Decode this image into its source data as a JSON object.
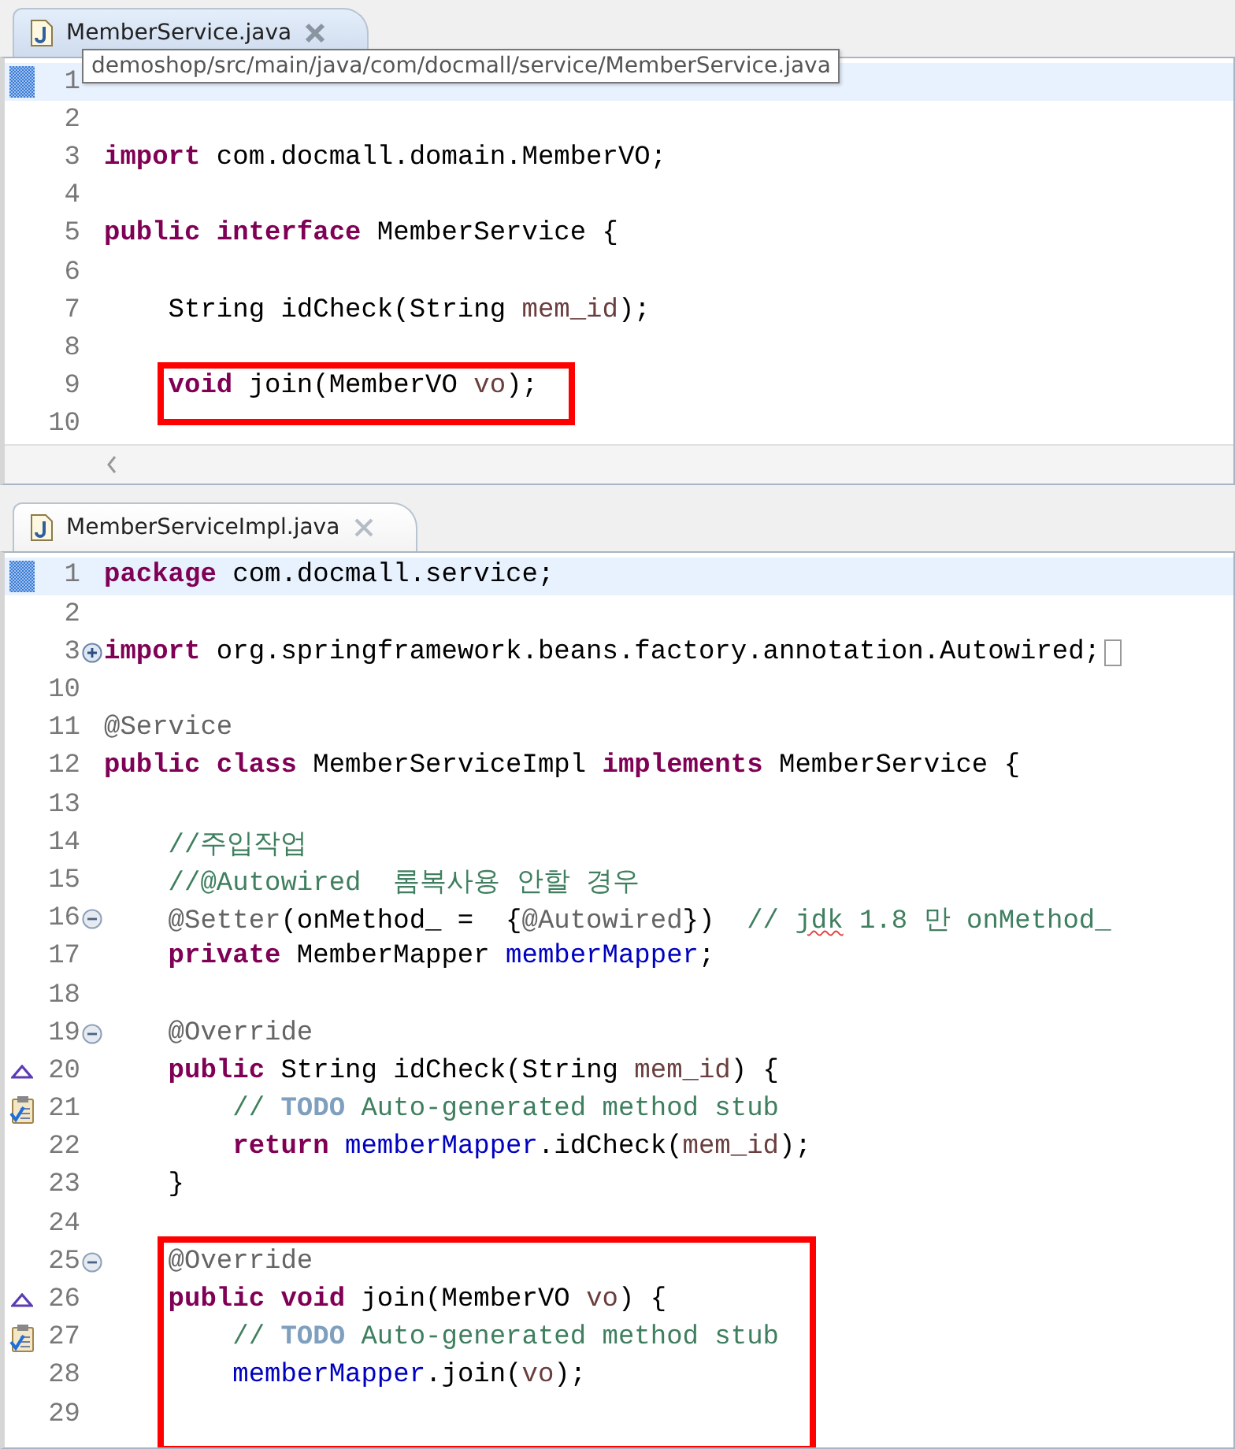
{
  "editors": [
    {
      "tab": {
        "label": "MemberService.java",
        "selected": true
      },
      "tooltip": {
        "text": "demoshop/src/main/java/com/docmall/service/MemberService.java"
      },
      "lines": [
        {
          "number": "1",
          "kind": "current",
          "boxed": false
        },
        {
          "number": "2",
          "kind": "plain",
          "boxed": false
        },
        {
          "number": "3",
          "kind": "plain",
          "boxed": false,
          "tokens": [
            {
              "kind": "keyword",
              "text": "import"
            },
            {
              "kind": "plain",
              "text": " com.docmall.domain.MemberVO;"
            }
          ]
        },
        {
          "number": "4",
          "kind": "plain",
          "boxed": false
        },
        {
          "number": "5",
          "kind": "plain",
          "boxed": false,
          "tokens": [
            {
              "kind": "keyword",
              "text": "public interface"
            },
            {
              "kind": "plain",
              "text": " MemberService {"
            }
          ]
        },
        {
          "number": "6",
          "kind": "plain",
          "boxed": false
        },
        {
          "number": "7",
          "kind": "plain",
          "boxed": false,
          "tokens": [
            {
              "kind": "plain",
              "text": "    String idCheck(String "
            },
            {
              "kind": "param",
              "text": "mem_id"
            },
            {
              "kind": "plain",
              "text": ");"
            }
          ]
        },
        {
          "number": "8",
          "kind": "plain",
          "boxed": false
        },
        {
          "number": "9",
          "kind": "plain",
          "boxed": true,
          "tokens": [
            {
              "kind": "keyword",
              "text": "    void"
            },
            {
              "kind": "plain",
              "text": " join(MemberVO "
            },
            {
              "kind": "param",
              "text": "vo"
            },
            {
              "kind": "plain",
              "text": ");"
            }
          ]
        },
        {
          "number": "10",
          "kind": "plain",
          "boxed": false
        }
      ],
      "hscroll": true
    },
    {
      "tab": {
        "label": "MemberServiceImpl.java",
        "selected": false
      },
      "lines": [
        {
          "number": "1",
          "kind": "current",
          "boxed": false,
          "tokens": [
            {
              "kind": "keyword",
              "text": "package"
            },
            {
              "kind": "plain",
              "text": " com.docmall.service;"
            }
          ]
        },
        {
          "number": "2",
          "kind": "plain",
          "boxed": false
        },
        {
          "number": "3",
          "kind": "expand",
          "boxed": false,
          "tokens": [
            {
              "kind": "keyword",
              "text": "import"
            },
            {
              "kind": "plain",
              "text": " org.springframework.beans.factory.annotation.Autowired;"
            }
          ]
        },
        {
          "number": "10",
          "kind": "plain",
          "boxed": false
        },
        {
          "number": "11",
          "kind": "plain",
          "boxed": false,
          "tokens": [
            {
              "kind": "annotation",
              "text": "@Service"
            }
          ]
        },
        {
          "number": "12",
          "kind": "plain",
          "boxed": false,
          "tokens": [
            {
              "kind": "keyword",
              "text": "public class"
            },
            {
              "kind": "plain",
              "text": " MemberServiceImpl "
            },
            {
              "kind": "keyword",
              "text": "implements"
            },
            {
              "kind": "plain",
              "text": " MemberService {"
            }
          ]
        },
        {
          "number": "13",
          "kind": "plain",
          "boxed": false
        },
        {
          "number": "14",
          "kind": "plain",
          "boxed": false,
          "tokens": [
            {
              "kind": "comment",
              "text": "    //주입작업"
            }
          ]
        },
        {
          "number": "15",
          "kind": "plain",
          "boxed": false,
          "tokens": [
            {
              "kind": "comment",
              "text": "    //@Autowired  롬복사용 안할 경우"
            }
          ]
        },
        {
          "number": "16",
          "kind": "collapse",
          "boxed": false,
          "tokens": [
            {
              "kind": "annotation",
              "text": "    @Setter"
            },
            {
              "kind": "plain",
              "text": "(onMethod_ =  {"
            },
            {
              "kind": "annotation",
              "text": "@Autowired"
            },
            {
              "kind": "plain",
              "text": "})  "
            },
            {
              "kind": "comment",
              "text": "// "
            },
            {
              "kind": "misspelled",
              "text": "jdk"
            },
            {
              "kind": "comment",
              "text": " 1.8 만 onMethod_"
            }
          ]
        },
        {
          "number": "17",
          "kind": "plain",
          "boxed": false,
          "tokens": [
            {
              "kind": "keyword",
              "text": "    private"
            },
            {
              "kind": "plain",
              "text": " MemberMapper "
            },
            {
              "kind": "field",
              "text": "memberMapper"
            },
            {
              "kind": "plain",
              "text": ";"
            }
          ]
        },
        {
          "number": "18",
          "kind": "plain",
          "boxed": false
        },
        {
          "number": "19",
          "kind": "collapse",
          "boxed": false,
          "tokens": [
            {
              "kind": "annotation",
              "text": "    @Override"
            }
          ]
        },
        {
          "number": "20",
          "kind": "override",
          "boxed": false,
          "tokens": [
            {
              "kind": "keyword",
              "text": "    public"
            },
            {
              "kind": "plain",
              "text": " String idCheck(String "
            },
            {
              "kind": "param",
              "text": "mem_id"
            },
            {
              "kind": "plain",
              "text": ") {"
            }
          ]
        },
        {
          "number": "21",
          "kind": "task",
          "boxed": false,
          "tokens": [
            {
              "kind": "comment",
              "text": "        // "
            },
            {
              "kind": "todo",
              "text": "TODO"
            },
            {
              "kind": "comment",
              "text": " Auto-generated method stub"
            }
          ]
        },
        {
          "number": "22",
          "kind": "plain",
          "boxed": false,
          "tokens": [
            {
              "kind": "keyword",
              "text": "        return"
            },
            {
              "kind": "field",
              "text": " memberMapper"
            },
            {
              "kind": "plain",
              "text": ".idCheck("
            },
            {
              "kind": "param",
              "text": "mem_id"
            },
            {
              "kind": "plain",
              "text": ");"
            }
          ]
        },
        {
          "number": "23",
          "kind": "plain",
          "boxed": false,
          "tokens": [
            {
              "kind": "plain",
              "text": "    }"
            }
          ]
        },
        {
          "number": "24",
          "kind": "plain",
          "boxed": false
        },
        {
          "number": "25",
          "kind": "collapse",
          "boxed": true,
          "tokens": [
            {
              "kind": "annotation",
              "text": "    @Override"
            }
          ]
        },
        {
          "number": "26",
          "kind": "override",
          "boxed": true,
          "tokens": [
            {
              "kind": "keyword",
              "text": "    public void"
            },
            {
              "kind": "plain",
              "text": " join(MemberVO "
            },
            {
              "kind": "param",
              "text": "vo"
            },
            {
              "kind": "plain",
              "text": ") {"
            }
          ]
        },
        {
          "number": "27",
          "kind": "task",
          "boxed": true,
          "tokens": [
            {
              "kind": "comment",
              "text": "        // "
            },
            {
              "kind": "todo",
              "text": "TODO"
            },
            {
              "kind": "comment",
              "text": " Auto-generated method stub"
            }
          ]
        },
        {
          "number": "28",
          "kind": "plain",
          "boxed": true,
          "tokens": [
            {
              "kind": "field",
              "text": "        memberMapper"
            },
            {
              "kind": "plain",
              "text": ".join("
            },
            {
              "kind": "param",
              "text": "vo"
            },
            {
              "kind": "plain",
              "text": ");"
            }
          ]
        },
        {
          "number": "29",
          "kind": "plain",
          "boxed": true
        }
      ],
      "hscroll": false
    }
  ]
}
